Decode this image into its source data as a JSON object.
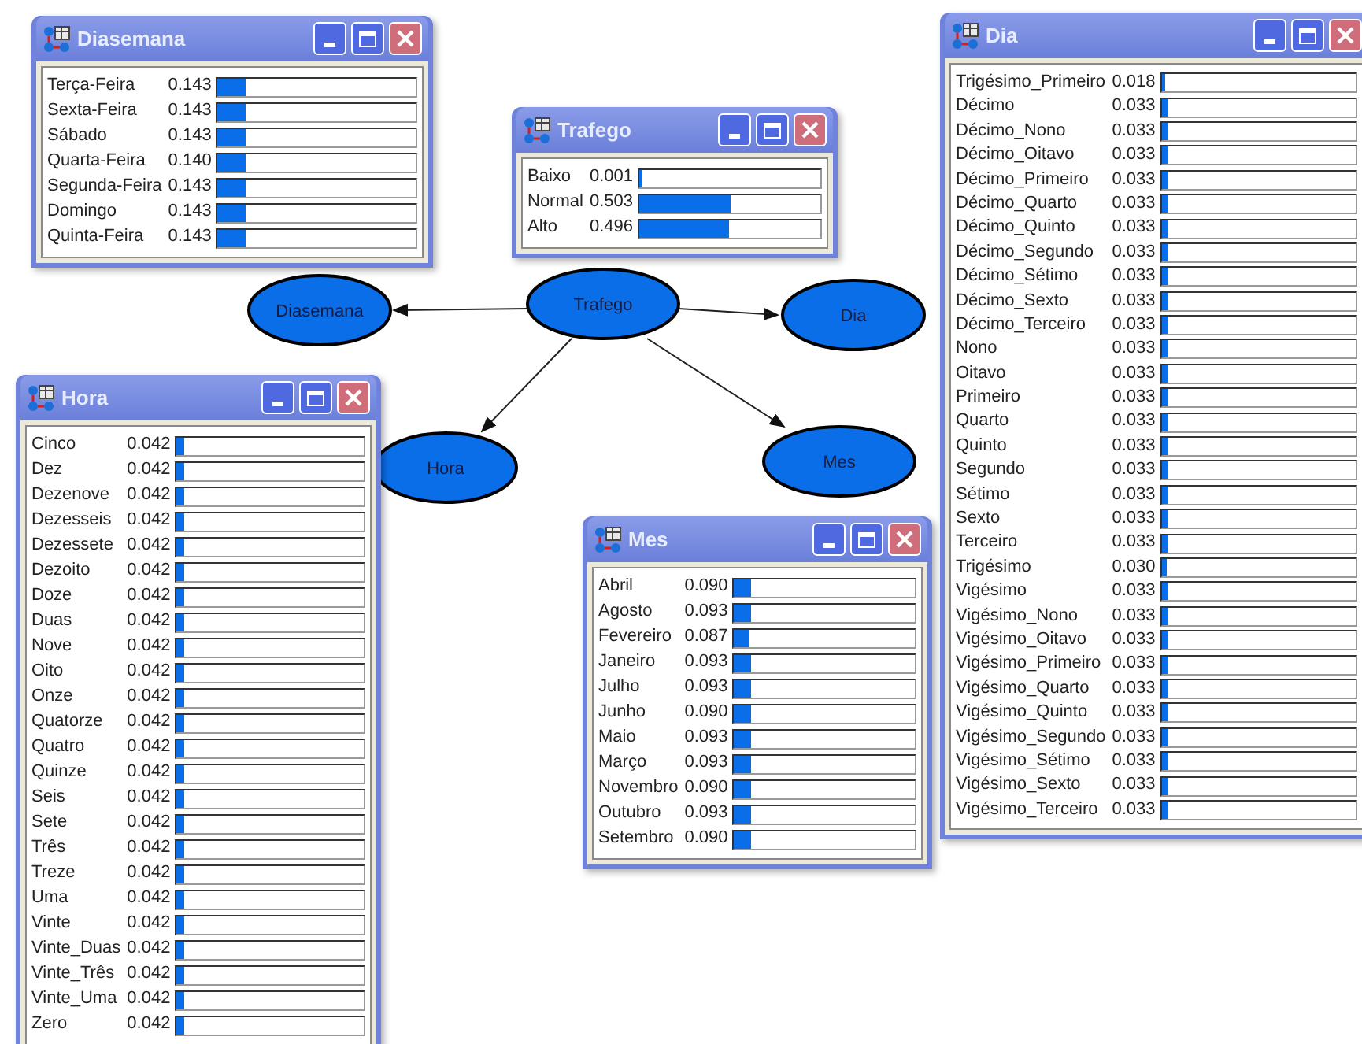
{
  "windows": [
    {
      "title": "Diasemana",
      "states": [
        {
          "name": "Terça-Feira",
          "value": "0.143",
          "level": 0.143
        },
        {
          "name": "Sexta-Feira",
          "value": "0.143",
          "level": 0.143
        },
        {
          "name": "Sábado",
          "value": "0.143",
          "level": 0.143
        },
        {
          "name": "Quarta-Feira",
          "value": "0.140",
          "level": 0.14
        },
        {
          "name": "Segunda-Feira",
          "value": "0.143",
          "level": 0.143
        },
        {
          "name": "Domingo",
          "value": "0.143",
          "level": 0.143
        },
        {
          "name": "Quinta-Feira",
          "value": "0.143",
          "level": 0.143
        }
      ]
    },
    {
      "title": "Trafego",
      "states": [
        {
          "name": "Baixo",
          "value": "0.001",
          "level": 0.001
        },
        {
          "name": "Normal",
          "value": "0.503",
          "level": 0.503
        },
        {
          "name": "Alto",
          "value": "0.496",
          "level": 0.496
        }
      ]
    },
    {
      "title": "Hora",
      "states": [
        {
          "name": "Cinco",
          "value": "0.042",
          "level": 0.042
        },
        {
          "name": "Dez",
          "value": "0.042",
          "level": 0.042
        },
        {
          "name": "Dezenove",
          "value": "0.042",
          "level": 0.042
        },
        {
          "name": "Dezesseis",
          "value": "0.042",
          "level": 0.042
        },
        {
          "name": "Dezessete",
          "value": "0.042",
          "level": 0.042
        },
        {
          "name": "Dezoito",
          "value": "0.042",
          "level": 0.042
        },
        {
          "name": "Doze",
          "value": "0.042",
          "level": 0.042
        },
        {
          "name": "Duas",
          "value": "0.042",
          "level": 0.042
        },
        {
          "name": "Nove",
          "value": "0.042",
          "level": 0.042
        },
        {
          "name": "Oito",
          "value": "0.042",
          "level": 0.042
        },
        {
          "name": "Onze",
          "value": "0.042",
          "level": 0.042
        },
        {
          "name": "Quatorze",
          "value": "0.042",
          "level": 0.042
        },
        {
          "name": "Quatro",
          "value": "0.042",
          "level": 0.042
        },
        {
          "name": "Quinze",
          "value": "0.042",
          "level": 0.042
        },
        {
          "name": "Seis",
          "value": "0.042",
          "level": 0.042
        },
        {
          "name": "Sete",
          "value": "0.042",
          "level": 0.042
        },
        {
          "name": "Três",
          "value": "0.042",
          "level": 0.042
        },
        {
          "name": "Treze",
          "value": "0.042",
          "level": 0.042
        },
        {
          "name": "Uma",
          "value": "0.042",
          "level": 0.042
        },
        {
          "name": "Vinte",
          "value": "0.042",
          "level": 0.042
        },
        {
          "name": "Vinte_Duas",
          "value": "0.042",
          "level": 0.042
        },
        {
          "name": "Vinte_Três",
          "value": "0.042",
          "level": 0.042
        },
        {
          "name": "Vinte_Uma",
          "value": "0.042",
          "level": 0.042
        },
        {
          "name": "Zero",
          "value": "0.042",
          "level": 0.042
        }
      ]
    },
    {
      "title": "Mes",
      "states": [
        {
          "name": "Abril",
          "value": "0.090",
          "level": 0.09
        },
        {
          "name": "Agosto",
          "value": "0.093",
          "level": 0.093
        },
        {
          "name": "Fevereiro",
          "value": "0.087",
          "level": 0.087
        },
        {
          "name": "Janeiro",
          "value": "0.093",
          "level": 0.093
        },
        {
          "name": "Julho",
          "value": "0.093",
          "level": 0.093
        },
        {
          "name": "Junho",
          "value": "0.090",
          "level": 0.09
        },
        {
          "name": "Maio",
          "value": "0.093",
          "level": 0.093
        },
        {
          "name": "Março",
          "value": "0.093",
          "level": 0.093
        },
        {
          "name": "Novembro",
          "value": "0.090",
          "level": 0.09
        },
        {
          "name": "Outubro",
          "value": "0.093",
          "level": 0.093
        },
        {
          "name": "Setembro",
          "value": "0.090",
          "level": 0.09
        }
      ]
    },
    {
      "title": "Dia",
      "states": [
        {
          "name": "Trigésimo_Primeiro",
          "value": "0.018",
          "level": 0.018
        },
        {
          "name": "Décimo",
          "value": "0.033",
          "level": 0.033
        },
        {
          "name": "Décimo_Nono",
          "value": "0.033",
          "level": 0.033
        },
        {
          "name": "Décimo_Oitavo",
          "value": "0.033",
          "level": 0.033
        },
        {
          "name": "Décimo_Primeiro",
          "value": "0.033",
          "level": 0.033
        },
        {
          "name": "Décimo_Quarto",
          "value": "0.033",
          "level": 0.033
        },
        {
          "name": "Décimo_Quinto",
          "value": "0.033",
          "level": 0.033
        },
        {
          "name": "Décimo_Segundo",
          "value": "0.033",
          "level": 0.033
        },
        {
          "name": "Décimo_Sétimo",
          "value": "0.033",
          "level": 0.033
        },
        {
          "name": "Décimo_Sexto",
          "value": "0.033",
          "level": 0.033
        },
        {
          "name": "Décimo_Terceiro",
          "value": "0.033",
          "level": 0.033
        },
        {
          "name": "Nono",
          "value": "0.033",
          "level": 0.033
        },
        {
          "name": "Oitavo",
          "value": "0.033",
          "level": 0.033
        },
        {
          "name": "Primeiro",
          "value": "0.033",
          "level": 0.033
        },
        {
          "name": "Quarto",
          "value": "0.033",
          "level": 0.033
        },
        {
          "name": "Quinto",
          "value": "0.033",
          "level": 0.033
        },
        {
          "name": "Segundo",
          "value": "0.033",
          "level": 0.033
        },
        {
          "name": "Sétimo",
          "value": "0.033",
          "level": 0.033
        },
        {
          "name": "Sexto",
          "value": "0.033",
          "level": 0.033
        },
        {
          "name": "Terceiro",
          "value": "0.033",
          "level": 0.033
        },
        {
          "name": "Trigésimo",
          "value": "0.030",
          "level": 0.03
        },
        {
          "name": "Vigésimo",
          "value": "0.033",
          "level": 0.033
        },
        {
          "name": "Vigésimo_Nono",
          "value": "0.033",
          "level": 0.033
        },
        {
          "name": "Vigésimo_Oitavo",
          "value": "0.033",
          "level": 0.033
        },
        {
          "name": "Vigésimo_Primeiro",
          "value": "0.033",
          "level": 0.033
        },
        {
          "name": "Vigésimo_Quarto",
          "value": "0.033",
          "level": 0.033
        },
        {
          "name": "Vigésimo_Quinto",
          "value": "0.033",
          "level": 0.033
        },
        {
          "name": "Vigésimo_Segundo",
          "value": "0.033",
          "level": 0.033
        },
        {
          "name": "Vigésimo_Sétimo",
          "value": "0.033",
          "level": 0.033
        },
        {
          "name": "Vigésimo_Sexto",
          "value": "0.033",
          "level": 0.033
        },
        {
          "name": "Vigésimo_Terceiro",
          "value": "0.033",
          "level": 0.033
        }
      ]
    }
  ],
  "nodes": [
    {
      "label": "Diasemana"
    },
    {
      "label": "Trafego"
    },
    {
      "label": "Dia"
    },
    {
      "label": "Hora"
    },
    {
      "label": "Mes"
    }
  ]
}
